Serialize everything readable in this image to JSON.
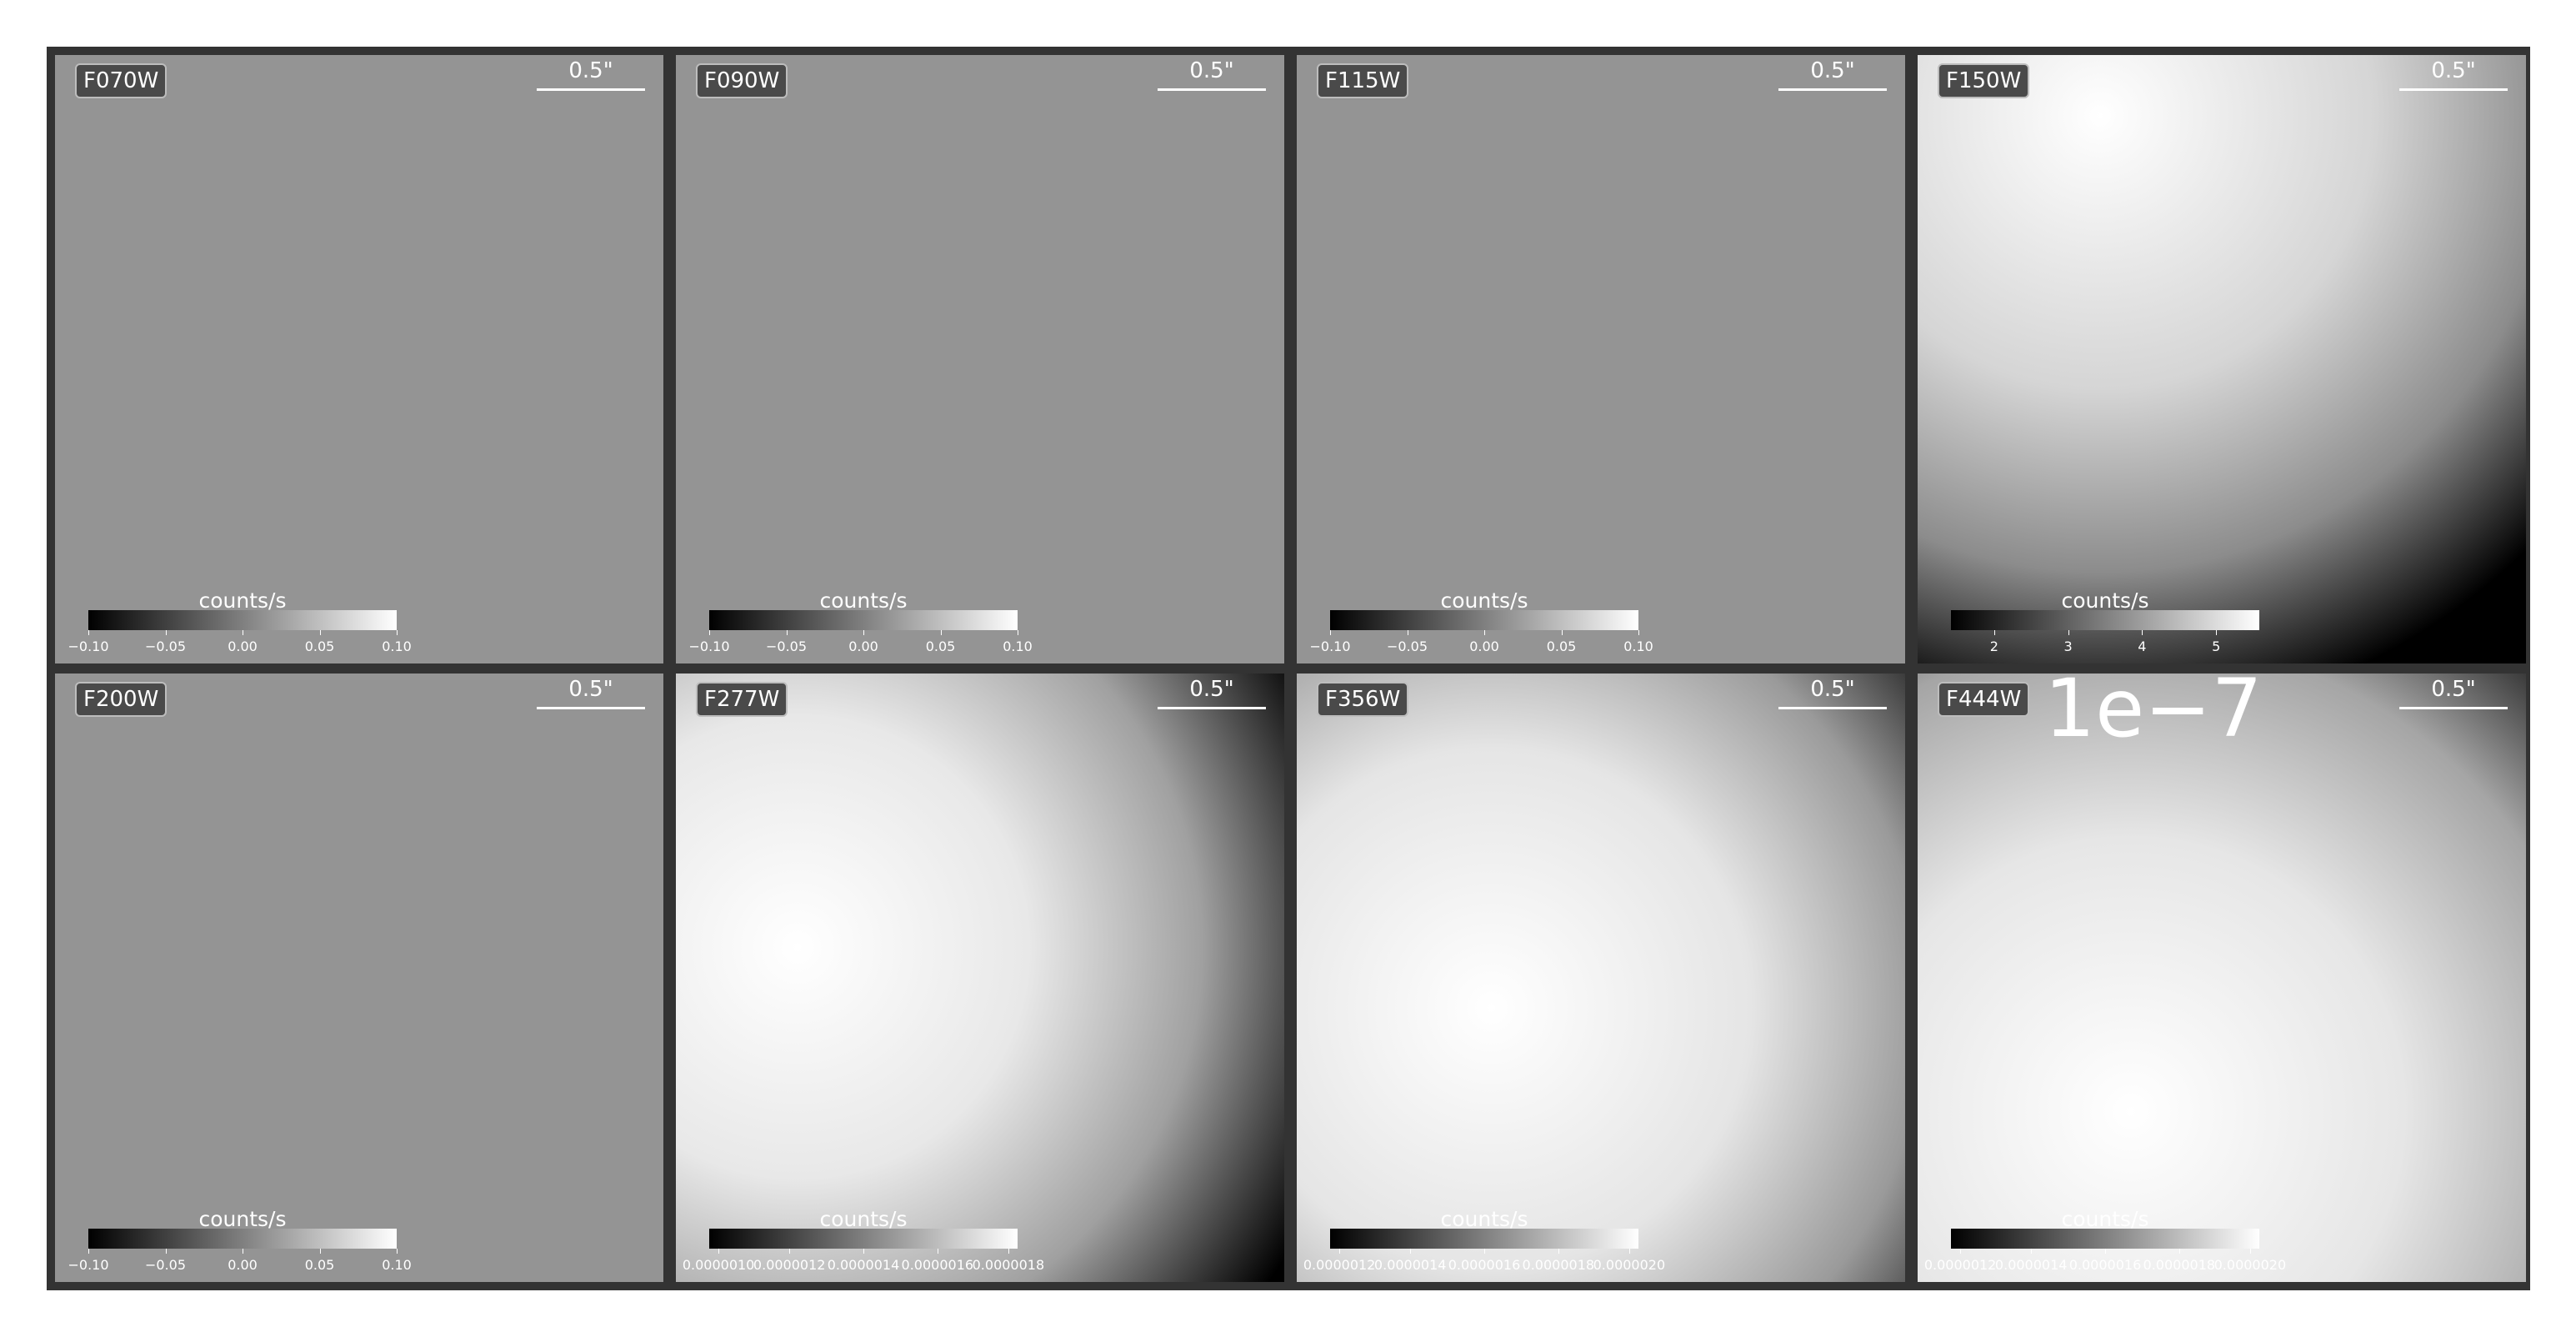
{
  "panels": [
    {
      "filter": "F070W",
      "scale_label": "0.5\"",
      "colorbar_label": "counts/s",
      "ticks": [
        "−0.10",
        "−0.05",
        "0.00",
        "0.05",
        "0.10"
      ],
      "ticks_pos": [
        0,
        0.25,
        0.5,
        0.75,
        1
      ],
      "offset_text": "",
      "image": "flat"
    },
    {
      "filter": "F090W",
      "scale_label": "0.5\"",
      "colorbar_label": "counts/s",
      "ticks": [
        "−0.10",
        "−0.05",
        "0.00",
        "0.05",
        "0.10"
      ],
      "ticks_pos": [
        0,
        0.25,
        0.5,
        0.75,
        1
      ],
      "offset_text": "",
      "image": "flat"
    },
    {
      "filter": "F115W",
      "scale_label": "0.5\"",
      "colorbar_label": "counts/s",
      "ticks": [
        "−0.10",
        "−0.05",
        "0.00",
        "0.05",
        "0.10"
      ],
      "ticks_pos": [
        0,
        0.25,
        0.5,
        0.75,
        1
      ],
      "offset_text": "",
      "image": "flat"
    },
    {
      "filter": "F150W",
      "scale_label": "0.5\"",
      "colorbar_label": "counts/s",
      "ticks": [
        "2",
        "3",
        "4",
        "5"
      ],
      "ticks_pos": [
        0.14,
        0.38,
        0.62,
        0.86
      ],
      "offset_text": "",
      "image": "blob-topleft"
    },
    {
      "filter": "F200W",
      "scale_label": "0.5\"",
      "colorbar_label": "counts/s",
      "ticks": [
        "−0.10",
        "−0.05",
        "0.00",
        "0.05",
        "0.10"
      ],
      "ticks_pos": [
        0,
        0.25,
        0.5,
        0.75,
        1
      ],
      "offset_text": "",
      "image": "flat"
    },
    {
      "filter": "F277W",
      "scale_label": "0.5\"",
      "colorbar_label": "counts/s",
      "ticks": [
        "0.0000010",
        "0.0000012",
        "0.0000014",
        "0.0000016",
        "0.0000018"
      ],
      "ticks_pos": [
        0.03,
        0.26,
        0.5,
        0.74,
        0.97
      ],
      "offset_text": "",
      "image": "blob-left"
    },
    {
      "filter": "F356W",
      "scale_label": "0.5\"",
      "colorbar_label": "counts/s",
      "ticks": [
        "0.0000012",
        "0.0000014",
        "0.0000016",
        "0.0000018",
        "0.0000020"
      ],
      "ticks_pos": [
        0.03,
        0.26,
        0.5,
        0.74,
        0.97
      ],
      "offset_text": "",
      "image": "blob-midleft"
    },
    {
      "filter": "F444W",
      "scale_label": "0.5\"",
      "colorbar_label": "counts/s",
      "ticks": [
        "0.0000012",
        "0.0000014",
        "0.0000016",
        "0.0000018",
        "0.0000020"
      ],
      "ticks_pos": [
        0.03,
        0.26,
        0.5,
        0.74,
        0.97
      ],
      "offset_text": "1e−7",
      "image": "blob-bottomleft"
    }
  ]
}
